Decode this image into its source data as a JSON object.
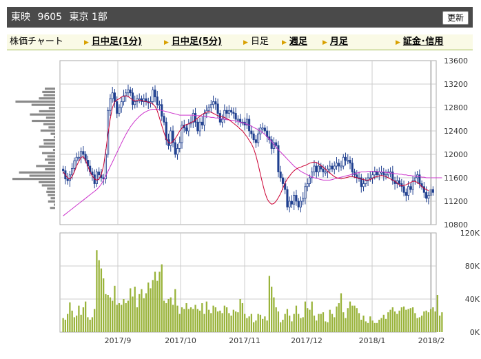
{
  "header": {
    "company": "東映",
    "code": "9605",
    "market": "東京 1部",
    "refresh_label": "更新"
  },
  "nav": {
    "chart_label": "株価チャート",
    "intraday_1": "日中足(1分)",
    "intraday_5": "日中足(5分)",
    "daily": "日足",
    "weekly": "週足",
    "monthly": "月足",
    "margin": "証金･信用"
  },
  "colors": {
    "candle": "#1f3f8f",
    "ma_short": "#cc0033",
    "ma_long": "#cc33cc",
    "volume": "#99b33a",
    "volume_profile": "#8a8a8a",
    "grid": "#cccccc",
    "header_bg": "#4a4a4a",
    "nav_bg": "#fafae6"
  },
  "chart_data": [
    {
      "type": "candlestick",
      "title": "",
      "price_axis": {
        "labels": [
          "13600",
          "13200",
          "12800",
          "12400",
          "12000",
          "11600",
          "11200",
          "10800"
        ],
        "ylim": [
          10800,
          13600
        ]
      },
      "x_labels": [
        "2017/9",
        "2017/10",
        "2017/11",
        "2017/12",
        "2018/1",
        "2018/2"
      ],
      "grid": true,
      "close": [
        11720,
        11580,
        11550,
        11650,
        11760,
        11890,
        11950,
        11950,
        12050,
        12000,
        11900,
        11800,
        11700,
        11650,
        11500,
        11700,
        11650,
        11600,
        11580,
        12000,
        12750,
        12950,
        13050,
        12900,
        12700,
        12800,
        12900,
        13000,
        13050,
        13100,
        13050,
        12850,
        12900,
        12950,
        12950,
        12900,
        12950,
        12900,
        12880,
        12900,
        13100,
        12980,
        12850,
        12850,
        12650,
        12550,
        12250,
        12150,
        12400,
        12200,
        12000,
        12100,
        12200,
        12500,
        12450,
        12400,
        12520,
        12550,
        12700,
        12550,
        12400,
        12550,
        12500,
        12700,
        12750,
        12800,
        12850,
        12900,
        12860,
        12700,
        12550,
        12600,
        12750,
        12700,
        12750,
        12720,
        12700,
        12600,
        12600,
        12550,
        12550,
        12500,
        12600,
        12400,
        12350,
        12250,
        12200,
        12350,
        12450,
        12450,
        12400,
        12300,
        12250,
        12100,
        12200,
        12150,
        11700,
        11600,
        11500,
        11400,
        11100,
        11200,
        11150,
        11300,
        11200,
        11100,
        11200,
        11250,
        11450,
        11500,
        11600,
        11700,
        11800,
        11700,
        11800,
        11750,
        11700,
        11700,
        11750,
        11800,
        11750,
        11800,
        11850,
        11800,
        11800,
        11950,
        11900,
        11900,
        11850,
        11700,
        11650,
        11600,
        11600,
        11450,
        11500,
        11550,
        11600,
        11600,
        11650,
        11700,
        11650,
        11700,
        11700,
        11650,
        11650,
        11700,
        11700,
        11550,
        11500,
        11550,
        11500,
        11450,
        11350,
        11300,
        11450,
        11400,
        11550,
        11600,
        11650,
        11500,
        11450,
        11350,
        11250,
        11300,
        11400,
        11350
      ],
      "ma_short": [
        11700,
        11650,
        11600,
        11580,
        11620,
        11700,
        11800,
        11880,
        11950,
        11960,
        11900,
        11800,
        11700,
        11630,
        11580,
        11560,
        11580,
        11650,
        11800,
        12050,
        12350,
        12600,
        12800,
        12900,
        12930,
        12950,
        12980,
        12990,
        13000,
        12990,
        12960,
        12930,
        12910,
        12920,
        12930,
        12920,
        12910,
        12900,
        12890,
        12880,
        12860,
        12820,
        12740,
        12620,
        12490,
        12370,
        12260,
        12200,
        12190,
        12220,
        12270,
        12330,
        12400,
        12450,
        12490,
        12510,
        12520,
        12540,
        12560,
        12590,
        12620,
        12650,
        12680,
        12700,
        12720,
        12730,
        12720,
        12700,
        12680,
        12660,
        12650,
        12640,
        12630,
        12610,
        12590,
        12560,
        12530,
        12500,
        12470,
        12430,
        12400,
        12350,
        12300,
        12240,
        12180,
        12100,
        11980,
        11830,
        11660,
        11500,
        11350,
        11240,
        11180,
        11150,
        11160,
        11200,
        11260,
        11330,
        11420,
        11510,
        11580,
        11630,
        11680,
        11720,
        11750,
        11770,
        11780,
        11800,
        11810,
        11830,
        11850,
        11860,
        11870,
        11860,
        11840,
        11810,
        11780,
        11750,
        11710,
        11680,
        11650,
        11620,
        11600,
        11590,
        11580,
        11590,
        11600,
        11610,
        11620,
        11620,
        11610,
        11600,
        11590,
        11580,
        11570,
        11560,
        11560,
        11570,
        11590,
        11610,
        11620,
        11630,
        11640,
        11630,
        11620,
        11600,
        11580,
        11560,
        11540,
        11510,
        11480,
        11460,
        11470,
        11480,
        11500,
        11520,
        11540,
        11540,
        11520,
        11490,
        11450,
        11420,
        11400,
        11380
      ],
      "ma_long": [
        10950,
        10980,
        11010,
        11040,
        11070,
        11100,
        11130,
        11160,
        11190,
        11220,
        11250,
        11280,
        11310,
        11340,
        11370,
        11400,
        11440,
        11490,
        11560,
        11630,
        11710,
        11790,
        11870,
        11950,
        12030,
        12110,
        12190,
        12270,
        12340,
        12410,
        12470,
        12520,
        12570,
        12610,
        12650,
        12680,
        12710,
        12730,
        12750,
        12760,
        12770,
        12770,
        12770,
        12760,
        12750,
        12740,
        12730,
        12720,
        12710,
        12700,
        12690,
        12680,
        12670,
        12670,
        12670,
        12670,
        12670,
        12670,
        12670,
        12660,
        12660,
        12660,
        12650,
        12650,
        12640,
        12640,
        12630,
        12630,
        12620,
        12620,
        12610,
        12610,
        12600,
        12590,
        12590,
        12580,
        12580,
        12570,
        12560,
        12550,
        12540,
        12530,
        12510,
        12500,
        12480,
        12460,
        12440,
        12420,
        12400,
        12370,
        12340,
        12300,
        12260,
        12220,
        12170,
        12120,
        12080,
        12040,
        12000,
        11960,
        11920,
        11880,
        11840,
        11800,
        11770,
        11740,
        11710,
        11690,
        11670,
        11650,
        11630,
        11610,
        11600,
        11590,
        11580,
        11570,
        11560,
        11560,
        11560,
        11560,
        11570,
        11580,
        11590,
        11600,
        11610,
        11620,
        11630,
        11640,
        11650,
        11660,
        11670,
        11680,
        11690,
        11700,
        11700,
        11700,
        11710,
        11710,
        11710,
        11710,
        11710,
        11700,
        11700,
        11700,
        11690,
        11690,
        11680,
        11680,
        11670,
        11670,
        11660,
        11660,
        11650,
        11650,
        11640,
        11640,
        11630,
        11630,
        11620,
        11620,
        11610,
        11610,
        11600,
        11600,
        11600,
        11600,
        11600,
        11600,
        11600,
        11600
      ],
      "volume_profile_price_range": [
        11000,
        13200
      ]
    },
    {
      "type": "bar",
      "title": "",
      "volume_axis": {
        "labels": [
          "120K",
          "80K",
          "40K",
          "0K"
        ],
        "ylim": [
          0,
          120000
        ]
      },
      "x_labels": [
        "2017/9",
        "2017/10",
        "2017/11",
        "2017/12",
        "2018/1",
        "2018/2"
      ],
      "grid": true,
      "values": [
        17000,
        15000,
        22000,
        36000,
        26000,
        18000,
        20000,
        32000,
        21000,
        30000,
        37000,
        18000,
        15000,
        18000,
        28000,
        99000,
        87000,
        77000,
        65000,
        46000,
        45000,
        42000,
        38000,
        56000,
        33000,
        35000,
        33000,
        40000,
        35000,
        38000,
        53000,
        43000,
        55000,
        30000,
        46000,
        52000,
        41000,
        47000,
        60000,
        53000,
        63000,
        73000,
        62000,
        73000,
        82000,
        38000,
        35000,
        40000,
        42000,
        33000,
        52000,
        32000,
        22000,
        30000,
        28000,
        35000,
        28000,
        30000,
        28000,
        33000,
        28000,
        26000,
        35000,
        22000,
        37000,
        27000,
        23000,
        32000,
        30000,
        25000,
        26000,
        23000,
        32000,
        30000,
        23000,
        20000,
        27000,
        25000,
        24000,
        40000,
        35000,
        22000,
        17000,
        19000,
        22000,
        12000,
        14000,
        22000,
        21000,
        16000,
        19000,
        14000,
        68000,
        55000,
        42000,
        30000,
        25000,
        12000,
        15000,
        22000,
        28000,
        20000,
        13000,
        22000,
        32000,
        22000,
        17000,
        18000,
        37000,
        29000,
        27000,
        37000,
        20000,
        14000,
        22000,
        22000,
        24000,
        13000,
        12000,
        27000,
        22000,
        18000,
        31000,
        35000,
        47000,
        24000,
        17000,
        29000,
        37000,
        32000,
        32000,
        29000,
        23000,
        15000,
        20000,
        13000,
        11000,
        19000,
        14000,
        11000,
        11000,
        15000,
        17000,
        21000,
        16000,
        24000,
        27000,
        30000,
        25000,
        22000,
        26000,
        30000,
        31000,
        27000,
        28000,
        29000,
        30000,
        23000,
        17000,
        18000,
        20000,
        25000,
        26000,
        24000,
        28000,
        30000,
        25000,
        45000,
        20000,
        24000
      ]
    }
  ]
}
